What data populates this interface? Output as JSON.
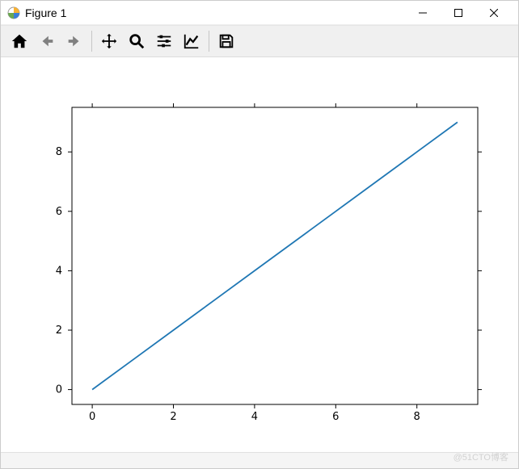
{
  "window": {
    "title": "Figure 1"
  },
  "toolbar": {
    "home": "Home",
    "back": "Back",
    "forward": "Forward",
    "pan": "Pan",
    "zoom": "Zoom",
    "subplots": "Configure subplots",
    "axes": "Edit axis",
    "save": "Save"
  },
  "watermark": "@51CTO博客",
  "chart_data": {
    "type": "line",
    "x": [
      0,
      1,
      2,
      3,
      4,
      5,
      6,
      7,
      8,
      9
    ],
    "y": [
      0,
      1,
      2,
      3,
      4,
      5,
      6,
      7,
      8,
      9
    ],
    "xticks": [
      0,
      2,
      4,
      6,
      8
    ],
    "yticks": [
      0,
      2,
      4,
      6,
      8
    ],
    "xlim": [
      -0.5,
      9.5
    ],
    "ylim": [
      -0.5,
      9.5
    ],
    "line_color": "#1f77b4",
    "title": "",
    "xlabel": "",
    "ylabel": ""
  }
}
